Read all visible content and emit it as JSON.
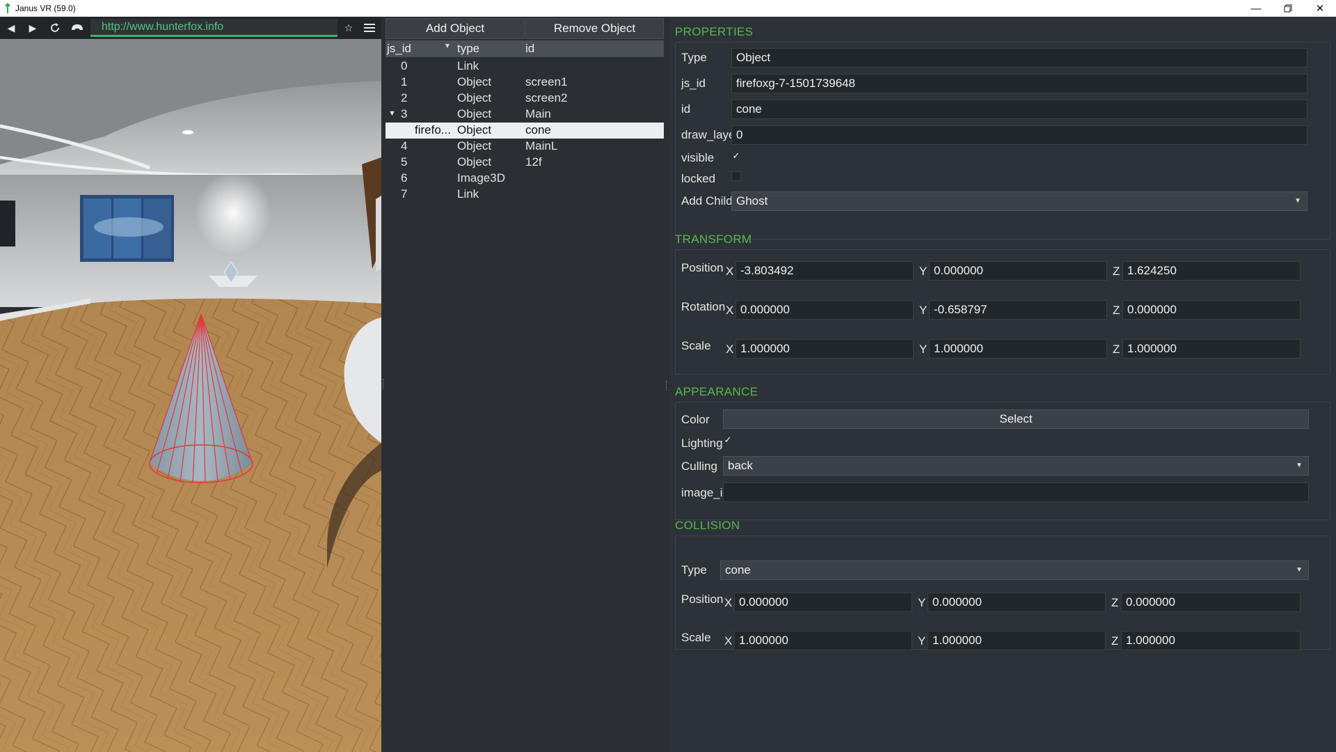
{
  "window": {
    "title": "Janus VR (59.0)",
    "minimize_icon": "minimize-icon",
    "maximize_icon": "restore-icon",
    "close_icon": "close-icon"
  },
  "toolbar": {
    "back_icon": "back-arrow-icon",
    "forward_icon": "forward-arrow-icon",
    "reload_icon": "reload-icon",
    "home_icon": "headset-icon",
    "url": "http://www.hunterfox.info",
    "bookmark_icon": "star-icon",
    "menu_icon": "hamburger-menu-icon",
    "url_color": "#57c47e"
  },
  "objects": {
    "add_label": "Add Object",
    "remove_label": "Remove Object",
    "headers": {
      "js_id": "js_id",
      "type": "type",
      "id": "id"
    },
    "rows": [
      {
        "js_id": "0",
        "type": "Link",
        "id": ""
      },
      {
        "js_id": "1",
        "type": "Object",
        "id": "screen1"
      },
      {
        "js_id": "2",
        "type": "Object",
        "id": "screen2"
      },
      {
        "js_id": "3",
        "type": "Object",
        "id": "Main",
        "expanded": true
      },
      {
        "js_id": "firefo...",
        "type": "Object",
        "id": "cone",
        "selected": true,
        "child": true
      },
      {
        "js_id": "4",
        "type": "Object",
        "id": "MainL"
      },
      {
        "js_id": "5",
        "type": "Object",
        "id": "12f"
      },
      {
        "js_id": "6",
        "type": "Image3D",
        "id": ""
      },
      {
        "js_id": "7",
        "type": "Link",
        "id": ""
      }
    ]
  },
  "properties": {
    "title": "PROPERTIES",
    "type_label": "Type",
    "type_value": "Object",
    "js_id_label": "js_id",
    "js_id_value": "firefoxg-7-1501739648",
    "id_label": "id",
    "id_value": "cone",
    "draw_layer_label": "draw_layer",
    "draw_layer_value": "0",
    "visible_label": "visible",
    "visible_checked": true,
    "locked_label": "locked",
    "locked_checked": false,
    "add_child_label": "Add Child",
    "add_child_value": "Ghost"
  },
  "transform": {
    "title": "TRANSFORM",
    "position_label": "Position",
    "rotation_label": "Rotation",
    "scale_label": "Scale",
    "axis_x": "X",
    "axis_y": "Y",
    "axis_z": "Z",
    "position": {
      "x": "-3.803492",
      "y": "0.000000",
      "z": "1.624250"
    },
    "rotation": {
      "x": "0.000000",
      "y": "-0.658797",
      "z": "0.000000"
    },
    "scale": {
      "x": "1.000000",
      "y": "1.000000",
      "z": "1.000000"
    }
  },
  "appearance": {
    "title": "APPEARANCE",
    "color_label": "Color",
    "color_button": "Select",
    "lighting_label": "Lighting",
    "lighting_checked": true,
    "culling_label": "Culling",
    "culling_value": "back",
    "image_id_label": "image_id",
    "image_id_value": ""
  },
  "collision": {
    "title": "COLLISION",
    "type_label": "Type",
    "type_value": "cone",
    "position_label": "Position",
    "scale_label": "Scale",
    "position": {
      "x": "0.000000",
      "y": "0.000000",
      "z": "0.000000"
    },
    "scale": {
      "x": "1.000000",
      "y": "1.000000",
      "z": "1.000000"
    }
  },
  "colors": {
    "section_title": "#5ab84b",
    "selection_bg": "#eceff1",
    "cone_edge": "#e0393e"
  },
  "checkmark": "✓"
}
